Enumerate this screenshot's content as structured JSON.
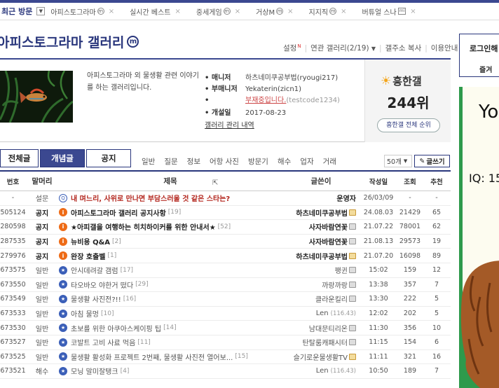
{
  "visit": {
    "title": "최근 방문",
    "items": [
      {
        "label": "아피스토그라마",
        "mark": "ⓜ"
      },
      {
        "label": "실시간 베스트",
        "mark": ""
      },
      {
        "label": "중세게임",
        "mark": "ⓜ"
      },
      {
        "label": "거상M",
        "mark": "ⓜ"
      },
      {
        "label": "지지직",
        "mark": "ⓜ"
      },
      {
        "label": "버튜얼 스나",
        "mark": "mini"
      }
    ]
  },
  "gallery": {
    "title": "아피스토그라마 갤러리",
    "mark": "ⓜ",
    "description": "아피스토그라마 외 물생활 관련 이야기를 하는 갤러리입니다.",
    "manager_label": "매니저",
    "manager": "하츠네미쿠공부법(ryougi217)",
    "submanager_label": "부매니저",
    "submanager_1": "Yekaterin(zicn1)",
    "submanager_2_status": "부재중입니다.",
    "submanager_2_id": "(testcode1234)",
    "opened_label": "개설일",
    "opened": "2017-08-23",
    "manage_link": "갤러리 관리 내역"
  },
  "topmenu": {
    "settings": "설정",
    "related": "연관 갤러리(2/19)",
    "copy_addr": "갤주소 복사",
    "guide": "이용안내"
  },
  "rank": {
    "label": "흥한갤",
    "value": "244위",
    "button": "흥한갤 전체 순위"
  },
  "tabs": [
    "전체글",
    "개념글",
    "공지"
  ],
  "heads": [
    "일반",
    "질문",
    "정보",
    "어항 사진",
    "방문기",
    "해수",
    "업자",
    "거래"
  ],
  "page_size": "50개",
  "write_button": "글쓰기",
  "columns": {
    "num": "번호",
    "head": "말머리",
    "title": "제목",
    "writer": "글쓴이",
    "date": "작성일",
    "views": "조회",
    "rec": "추천"
  },
  "rows": [
    {
      "num": "-",
      "head": "설문",
      "icon": "survey",
      "title": "내 며느리, 사위로 만나면 부담스러울 것 같은 스타는?",
      "comments": "",
      "writer": "운영자",
      "ip": "",
      "badge": "",
      "date": "26/03/09",
      "views": "-",
      "rec": "-",
      "type": "survey"
    },
    {
      "num": "505124",
      "head": "공지",
      "icon": "notice",
      "title": "아피스토그라마 갤러리 공지사항",
      "comments": "[19]",
      "writer": "하츠네미쿠공부법",
      "ip": "",
      "badge": "gold",
      "date": "24.08.03",
      "views": "21429",
      "rec": "65",
      "type": "notice"
    },
    {
      "num": "280598",
      "head": "공지",
      "icon": "notice",
      "title": "★아피갤을 여행하는 히치하이커를 위한 안내서★",
      "comments": "[52]",
      "writer": "사자바람연꽃",
      "ip": "",
      "badge": "gray",
      "date": "21.07.22",
      "views": "78001",
      "rec": "62",
      "type": "notice"
    },
    {
      "num": "287535",
      "head": "공지",
      "icon": "notice",
      "title": "뉴비용 Q&A",
      "comments": "[2]",
      "writer": "사자바람연꽃",
      "ip": "",
      "badge": "gray",
      "date": "21.08.13",
      "views": "29573",
      "rec": "19",
      "type": "notice"
    },
    {
      "num": "279976",
      "head": "공지",
      "icon": "notice",
      "title": "완장 호출벨",
      "comments": "[1]",
      "writer": "하츠네미쿠공부법",
      "ip": "",
      "badge": "gold",
      "date": "21.07.20",
      "views": "16098",
      "rec": "89",
      "type": "notice"
    },
    {
      "num": "673575",
      "head": "일반",
      "icon": "star",
      "title": "안시데려갈 갬럼",
      "comments": "[17]",
      "writer": "팽귄",
      "ip": "",
      "badge": "gray",
      "date": "15:02",
      "views": "159",
      "rec": "12",
      "type": "normal"
    },
    {
      "num": "673550",
      "head": "일반",
      "icon": "star",
      "title": "타오바오 야한거 떴다",
      "comments": "[29]",
      "writer": "까랑까랑",
      "ip": "",
      "badge": "gray",
      "date": "13:38",
      "views": "357",
      "rec": "7",
      "type": "normal"
    },
    {
      "num": "673549",
      "head": "일반",
      "icon": "star",
      "title": "물생활 사진전?!!",
      "comments": "[16]",
      "writer": "클라운킬리",
      "ip": "",
      "badge": "gray",
      "date": "13:30",
      "views": "222",
      "rec": "5",
      "type": "normal"
    },
    {
      "num": "673533",
      "head": "일반",
      "icon": "star",
      "title": "아침 물멍",
      "comments": "[10]",
      "writer": "Len",
      "ip": "(116.43)",
      "badge": "",
      "date": "12:02",
      "views": "202",
      "rec": "5",
      "type": "normal"
    },
    {
      "num": "673530",
      "head": "일반",
      "icon": "star",
      "title": "초보를 위한 아쿠아스케이핑 팁",
      "comments": "[14]",
      "writer": "남대문티리온",
      "ip": "",
      "badge": "gray",
      "date": "11:30",
      "views": "356",
      "rec": "10",
      "type": "normal"
    },
    {
      "num": "673527",
      "head": "일반",
      "icon": "star",
      "title": "코발트 고비 사료 먹음",
      "comments": "[11]",
      "writer": "탄탈룸캐패시터",
      "ip": "",
      "badge": "gray",
      "date": "11:15",
      "views": "154",
      "rec": "6",
      "type": "normal"
    },
    {
      "num": "673525",
      "head": "일반",
      "icon": "star",
      "title": "물생활 활성화 프로젝트 2번째, 물생활 사진전 열어보...",
      "comments": "[15]",
      "writer": "슬기로운물생활TV",
      "ip": "",
      "badge": "gold",
      "date": "11:11",
      "views": "321",
      "rec": "16",
      "type": "normal"
    },
    {
      "num": "673521",
      "head": "해수",
      "icon": "star",
      "title": "모닝 말미잘탱크",
      "comments": "[4]",
      "writer": "Len",
      "ip": "(116.43)",
      "badge": "",
      "date": "10:50",
      "views": "189",
      "rec": "7",
      "type": "normal"
    }
  ],
  "side": {
    "login": "로그인해",
    "sub": "즐겨",
    "ad_text_1": "Yo",
    "ad_text_2": "IQ: 15"
  },
  "colors": {
    "navy": "#3b4890",
    "notice_icon": "#ee6b16",
    "survey_title": "#b3261e",
    "ad_bg": "#2e9a4c"
  }
}
